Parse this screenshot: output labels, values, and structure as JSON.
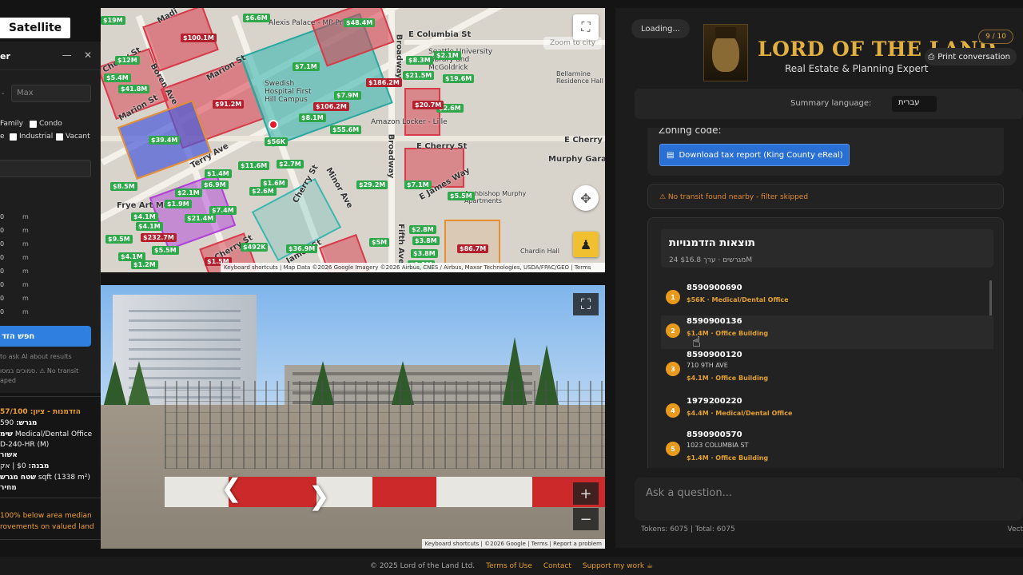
{
  "map": {
    "satellite_label": "Satellite",
    "attribution": "Keyboard shortcuts  |  Map Data ©2026 Google Imagery ©2026 Airbus, CNES / Airbus, Maxar Technologies, USDA/FPAC/GEO  |  Terms",
    "zoom_tooltip": "Zoom to city",
    "streets": [
      "Madi",
      "Marion St",
      "Boren Ave",
      "Marion St",
      "Cherry St",
      "Cherry St",
      "E Columbia St",
      "E Cherry St",
      "E Cherry St",
      "E James Way",
      "Broadway",
      "Minor Ave",
      "James St",
      "Cherry St",
      "Fifth Ave",
      "Murphy Garag",
      "Broadway",
      "Terry Ave",
      "Frye Art Mus"
    ],
    "places": [
      "Swedish Hospital First Hill Campus",
      "Amazon Locker - Lille",
      "Seattle University Library and McGoldrick",
      "Bellarmine Residence Hall",
      "Archbishop Murphy Apartments",
      "Chardin Hall",
      "Alexis Palace - MP Pr"
    ],
    "pins_green": [
      "$19M",
      "$6.6M",
      "$48.4M",
      "$12M",
      "$5.4M",
      "$41.8M",
      "$7.1M",
      "$8.3M",
      "$2.1M",
      "$21.5M",
      "$19.6M",
      "$7.9M",
      "$8.1M",
      "$55.6M",
      "$2.6M",
      "$39.4M",
      "$56K",
      "$11.6M",
      "$2.7M",
      "$1.4M",
      "$6.9M",
      "$1.6M",
      "$2.6M",
      "$8.5M",
      "$2.1M",
      "$1.9M",
      "$4.1M",
      "$21.4M",
      "$7.4M",
      "$4.1M",
      "$29.2M",
      "$7.1M",
      "$5.5M",
      "$5M",
      "$2.8M",
      "$3.8M",
      "$3.8M",
      "$9.5M",
      "$4.1M",
      "$1.2M",
      "$5.5M",
      "$492K",
      "$36.9M",
      "$1.1M"
    ],
    "pins_red": [
      "$100.1M",
      "$91.2M",
      "$186.2M",
      "$106.2M",
      "$20.7M",
      "$232.7M",
      "$1.5M",
      "$86.7M"
    ]
  },
  "filter": {
    "title": "er",
    "minimize": "—",
    "close": "✕",
    "min_sep": "-",
    "max_placeholder": "Max",
    "checkboxes": [
      {
        "label": "Family",
        "checked": false
      },
      {
        "label": "Condo",
        "checked": false
      },
      {
        "label": "e",
        "checked": false
      },
      {
        "label": "Industrial",
        "checked": false
      },
      {
        "label": "Vacant",
        "checked": false
      }
    ],
    "rows": [
      {
        "v": "0",
        "u": "m"
      },
      {
        "v": "0",
        "u": "m"
      },
      {
        "v": "0",
        "u": "m"
      },
      {
        "v": "0",
        "u": "m"
      },
      {
        "v": "0",
        "u": "m"
      },
      {
        "v": "0",
        "u": "m"
      },
      {
        "v": "0",
        "u": "m"
      },
      {
        "v": "0",
        "u": "m"
      }
    ],
    "search_label": "חפש הזד",
    "note1": "to ask AI about results",
    "note2": "סמוכים במסו. ⚠ No transit",
    "note3": "aped"
  },
  "info": {
    "line1": "הזדמנות - ציון: 57/100",
    "line2_label": "מגרש:",
    "line2_val": " 590",
    "line3_label": "שימ",
    "line3_val": " Medical/Dental Office",
    "line4": "D-240-HR (M)",
    "line5": "אשור",
    "line6_label": "מבנה:",
    "line6_val": " $0 | אק",
    "line7_label": "שטח מגרש",
    "line7_val": " sqft (1338 m²)",
    "line8": "מחיר",
    "line9": "100% below area median",
    "line10": "rovements on valued land"
  },
  "streetview": {
    "attribution": "Keyboard shortcuts  |  ©2026 Google  |  Terms  |  Report a problem",
    "zoom_in": "+",
    "zoom_out": "−",
    "expand": "⛶"
  },
  "chat": {
    "loading": "Loading...",
    "brand_title": "LORD OF THE LAND",
    "brand_sub": "Real Estate & Planning Expert",
    "counter": "9 / 10",
    "print_label": "Print conversation",
    "summary_label": "Summary language:",
    "summary_value": "עברית",
    "zoning_label": "Zoning code:",
    "download_label": "Download tax report (King County eReal)",
    "transit_note": "⚠ No transit found nearby - filter skipped",
    "results_title": "תוצאות הזדמנויות",
    "results_sub": "24 מגרשים · ערך $16.8M",
    "results": [
      {
        "num": "1",
        "id": "8590900690",
        "addr": "",
        "meta": "$56K · Medical/Dental Office"
      },
      {
        "num": "2",
        "id": "8590900136",
        "addr": "",
        "meta": "$1.4M · Office Building"
      },
      {
        "num": "3",
        "id": "8590900120",
        "addr": "710 9TH AVE",
        "meta": "$4.1M · Office Building"
      },
      {
        "num": "4",
        "id": "1979200220",
        "addr": "",
        "meta": "$4.4M · Medical/Dental Office"
      },
      {
        "num": "5",
        "id": "8590900570",
        "addr": "1023 COLUMBIA ST",
        "meta": "$1.4M · Office Building"
      }
    ],
    "ask_placeholder": "Ask a question...",
    "tokens": "Tokens: 6075 | Total: 6075",
    "vec": "Vect"
  },
  "footer": {
    "copyright": "© 2025 Lord of the Land Ltd.",
    "terms": "Terms of Use",
    "contact": "Contact",
    "support": "Support my work"
  },
  "colors": {
    "accent": "#e2b040",
    "primary_btn": "#2a6fd4",
    "parcel_red": "#d83a4a",
    "parcel_teal": "#3ab8b0",
    "parcel_blue": "#4a5ad8",
    "parcel_purple": "#b040d8",
    "parcel_orange": "#e89030"
  }
}
